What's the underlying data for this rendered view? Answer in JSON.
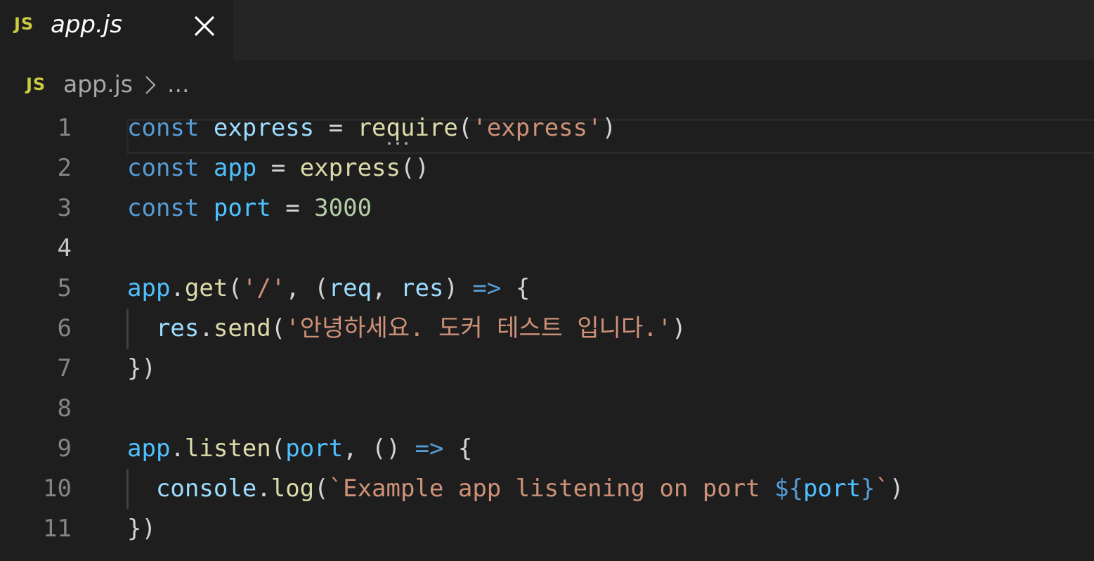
{
  "tab": {
    "icon_text": "JS",
    "title": "app.js",
    "close_icon": "close-icon"
  },
  "breadcrumb": {
    "icon_text": "JS",
    "file": "app.js",
    "separator_icon": "chevron-right-icon",
    "ellipsis": "..."
  },
  "colors": {
    "background": "#1e1e1e",
    "tabbar": "#252526",
    "js_icon": "#cbcb41",
    "keyword": "#569cd6",
    "variable": "#9cdcfe",
    "function": "#dcdcaa",
    "string": "#ce9178",
    "number": "#b5cea8"
  },
  "editor": {
    "active_line": 4,
    "lines": [
      {
        "number": "1",
        "tokens": [
          [
            "kw",
            "const"
          ],
          [
            "op",
            " "
          ],
          [
            "var",
            "express"
          ],
          [
            "op",
            " = "
          ],
          [
            "fn",
            "require"
          ],
          [
            "op",
            "("
          ],
          [
            "str",
            "'express'"
          ],
          [
            "op",
            ")"
          ]
        ]
      },
      {
        "number": "2",
        "tokens": [
          [
            "kw",
            "const"
          ],
          [
            "op",
            " "
          ],
          [
            "obj",
            "app"
          ],
          [
            "op",
            " = "
          ],
          [
            "fn",
            "express"
          ],
          [
            "op",
            "()"
          ]
        ]
      },
      {
        "number": "3",
        "tokens": [
          [
            "kw",
            "const"
          ],
          [
            "op",
            " "
          ],
          [
            "obj",
            "port"
          ],
          [
            "op",
            " = "
          ],
          [
            "num",
            "3000"
          ]
        ]
      },
      {
        "number": "4",
        "tokens": []
      },
      {
        "number": "5",
        "tokens": [
          [
            "obj",
            "app"
          ],
          [
            "op",
            "."
          ],
          [
            "fn",
            "get"
          ],
          [
            "op",
            "("
          ],
          [
            "str",
            "'/'"
          ],
          [
            "op",
            ", ("
          ],
          [
            "param",
            "req"
          ],
          [
            "op",
            ", "
          ],
          [
            "param",
            "res"
          ],
          [
            "op",
            ") "
          ],
          [
            "kw",
            "=>"
          ],
          [
            "op",
            " {"
          ]
        ]
      },
      {
        "number": "6",
        "tokens": [
          [
            "op",
            "  "
          ],
          [
            "var",
            "res"
          ],
          [
            "op",
            "."
          ],
          [
            "fn",
            "send"
          ],
          [
            "op",
            "("
          ],
          [
            "str",
            "'안녕하세요. 도커 테스트 입니다.'"
          ],
          [
            "op",
            ")"
          ]
        ]
      },
      {
        "number": "7",
        "tokens": [
          [
            "op",
            "})"
          ]
        ]
      },
      {
        "number": "8",
        "tokens": []
      },
      {
        "number": "9",
        "tokens": [
          [
            "obj",
            "app"
          ],
          [
            "op",
            "."
          ],
          [
            "fn",
            "listen"
          ],
          [
            "op",
            "("
          ],
          [
            "obj",
            "port"
          ],
          [
            "op",
            ", () "
          ],
          [
            "kw",
            "=>"
          ],
          [
            "op",
            " {"
          ]
        ]
      },
      {
        "number": "10",
        "tokens": [
          [
            "op",
            "  "
          ],
          [
            "var",
            "console"
          ],
          [
            "op",
            "."
          ],
          [
            "fn",
            "log"
          ],
          [
            "op",
            "("
          ],
          [
            "str",
            "`Example app listening on port "
          ],
          [
            "tpl",
            "${"
          ],
          [
            "obj",
            "port"
          ],
          [
            "tpl",
            "}"
          ],
          [
            "str",
            "`"
          ],
          [
            "op",
            ")"
          ]
        ]
      },
      {
        "number": "11",
        "tokens": [
          [
            "op",
            "})"
          ]
        ]
      }
    ]
  }
}
